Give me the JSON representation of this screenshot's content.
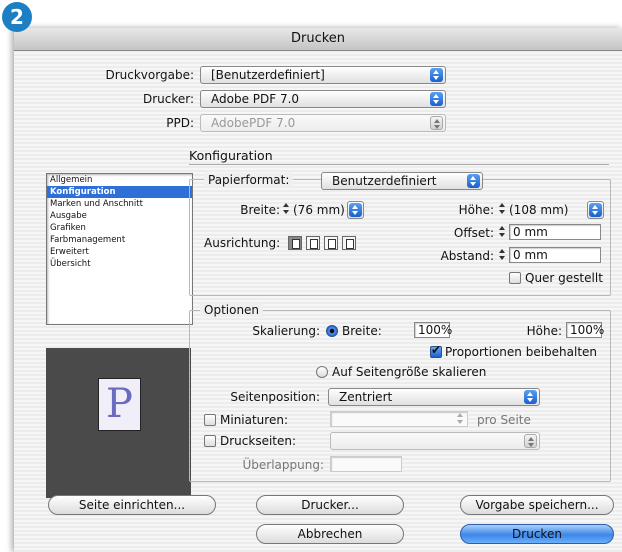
{
  "badge": "2",
  "window": {
    "title": "Drucken"
  },
  "top": {
    "preset_label": "Druckvorgabe:",
    "preset_value": "[Benutzerdefiniert]",
    "printer_label": "Drucker:",
    "printer_value": "Adobe PDF 7.0",
    "ppd_label": "PPD:",
    "ppd_value": "AdobePDF 7.0"
  },
  "sidebar": {
    "items": [
      {
        "label": "Allgemein"
      },
      {
        "label": "Konfiguration"
      },
      {
        "label": "Marken und Anschnitt"
      },
      {
        "label": "Ausgabe"
      },
      {
        "label": "Grafiken"
      },
      {
        "label": "Farbmanagement"
      },
      {
        "label": "Erweitert"
      },
      {
        "label": "Übersicht"
      }
    ],
    "selected": "Konfiguration"
  },
  "preview": {
    "letter": "P"
  },
  "konfiguration": {
    "heading": "Konfiguration",
    "paper_label": "Papierformat:",
    "paper_value": "Benutzerdefiniert",
    "width_label": "Breite:",
    "width_value": "(76 mm)",
    "height_label": "Höhe:",
    "height_value": "(108 mm)",
    "offset_label": "Offset:",
    "offset_value": "0 mm",
    "orientation_label": "Ausrichtung:",
    "gap_label": "Abstand:",
    "gap_value": "0 mm",
    "landscape_label": "Quer gestellt"
  },
  "optionen": {
    "heading": "Optionen",
    "scaling_label": "Skalierung:",
    "scale_width_label": "Breite:",
    "scale_width_value": "100%",
    "scale_height_label": "Höhe:",
    "scale_height_value": "100%",
    "proportions_label": "Proportionen beibehalten",
    "fit_label": "Auf Seitengröße skalieren",
    "position_label": "Seitenposition:",
    "position_value": "Zentriert",
    "thumbnails_label": "Miniaturen:",
    "per_page_label": "pro Seite",
    "tiles_label": "Druckseiten:",
    "overlap_label": "Überlappung:"
  },
  "buttons": {
    "page_setup": "Seite einrichten...",
    "printer": "Drucker...",
    "save_preset": "Vorgabe speichern...",
    "cancel": "Abbrechen",
    "print": "Drucken"
  }
}
